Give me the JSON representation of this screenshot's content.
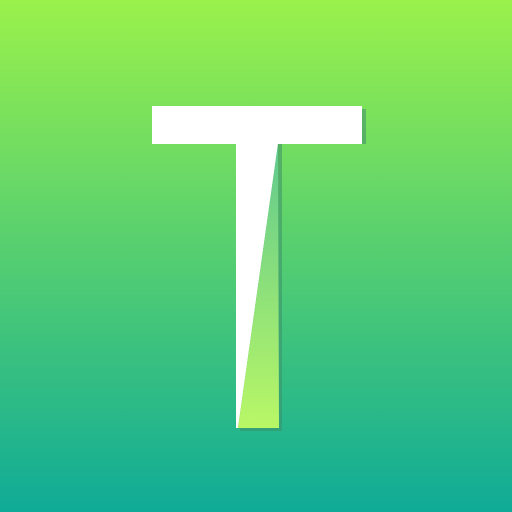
{
  "icon": {
    "name": "t-letter-icon",
    "letter": "T",
    "colors": {
      "gradient_top": "#9AF14B",
      "gradient_bottom": "#0FAB97",
      "letter_fill": "#FFFFFF",
      "letter_shadow": "#3E8E6A",
      "fold_top": "#5FC98F",
      "fold_bottom": "#B9F766"
    }
  }
}
